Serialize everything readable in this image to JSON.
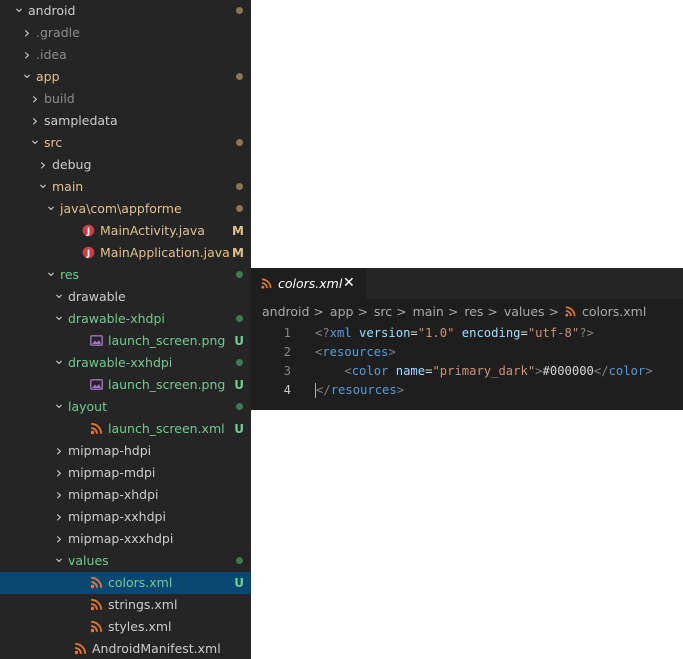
{
  "explorer": {
    "items": [
      {
        "label": "android",
        "depth": 0,
        "expanded": true,
        "status": "dot",
        "color": "#cccccc"
      },
      {
        "label": ".gradle",
        "depth": 1,
        "expanded": false,
        "status": "",
        "color": "#8b8b8b"
      },
      {
        "label": ".idea",
        "depth": 1,
        "expanded": false,
        "status": "",
        "color": "#8b8b8b"
      },
      {
        "label": "app",
        "depth": 1,
        "expanded": true,
        "status": "dot",
        "color": "#e2c08d"
      },
      {
        "label": "build",
        "depth": 2,
        "expanded": false,
        "status": "",
        "color": "#8b8b8b"
      },
      {
        "label": "sampledata",
        "depth": 2,
        "expanded": false,
        "status": "",
        "color": "#cccccc"
      },
      {
        "label": "src",
        "depth": 2,
        "expanded": true,
        "status": "dot",
        "color": "#e2c08d"
      },
      {
        "label": "debug",
        "depth": 3,
        "expanded": false,
        "status": "",
        "color": "#cccccc"
      },
      {
        "label": "main",
        "depth": 3,
        "expanded": true,
        "status": "dot",
        "color": "#e2c08d"
      },
      {
        "label": "java\\com\\appforme",
        "depth": 4,
        "expanded": true,
        "status": "dot",
        "color": "#e2c08d"
      },
      {
        "label": "MainActivity.java",
        "depth": 5,
        "file": "java",
        "status": "M",
        "color": "#e2c08d"
      },
      {
        "label": "MainApplication.java",
        "depth": 5,
        "file": "java",
        "status": "M",
        "color": "#e2c08d"
      },
      {
        "label": "res",
        "depth": 4,
        "expanded": true,
        "status": "dot",
        "color": "#73c991"
      },
      {
        "label": "drawable",
        "depth": 5,
        "expanded": true,
        "status": "",
        "color": "#cccccc"
      },
      {
        "label": "drawable-xhdpi",
        "depth": 5,
        "expanded": true,
        "status": "dot",
        "color": "#73c991"
      },
      {
        "label": "launch_screen.png",
        "depth": 6,
        "file": "image",
        "status": "U",
        "color": "#73c991"
      },
      {
        "label": "drawable-xxhdpi",
        "depth": 5,
        "expanded": true,
        "status": "dot",
        "color": "#73c991"
      },
      {
        "label": "launch_screen.png",
        "depth": 6,
        "file": "image",
        "status": "U",
        "color": "#73c991"
      },
      {
        "label": "layout",
        "depth": 5,
        "expanded": true,
        "status": "dot",
        "color": "#73c991"
      },
      {
        "label": "launch_screen.xml",
        "depth": 6,
        "file": "xml",
        "status": "U",
        "color": "#73c991"
      },
      {
        "label": "mipmap-hdpi",
        "depth": 5,
        "expanded": false,
        "status": "",
        "color": "#cccccc"
      },
      {
        "label": "mipmap-mdpi",
        "depth": 5,
        "expanded": false,
        "status": "",
        "color": "#cccccc"
      },
      {
        "label": "mipmap-xhdpi",
        "depth": 5,
        "expanded": false,
        "status": "",
        "color": "#cccccc"
      },
      {
        "label": "mipmap-xxhdpi",
        "depth": 5,
        "expanded": false,
        "status": "",
        "color": "#cccccc"
      },
      {
        "label": "mipmap-xxxhdpi",
        "depth": 5,
        "expanded": false,
        "status": "",
        "color": "#cccccc"
      },
      {
        "label": "values",
        "depth": 5,
        "expanded": true,
        "status": "dot",
        "color": "#73c991"
      },
      {
        "label": "colors.xml",
        "depth": 6,
        "file": "xml",
        "status": "U",
        "color": "#73c991",
        "selected": true
      },
      {
        "label": "strings.xml",
        "depth": 6,
        "file": "xml",
        "status": "",
        "color": "#cccccc"
      },
      {
        "label": "styles.xml",
        "depth": 6,
        "file": "xml",
        "status": "",
        "color": "#cccccc"
      },
      {
        "label": "AndroidManifest.xml",
        "depth": 4,
        "file": "xml",
        "status": "",
        "color": "#cccccc"
      }
    ]
  },
  "editor": {
    "tab": {
      "label": "colors.xml",
      "close": "✕"
    },
    "breadcrumb": [
      "android",
      "app",
      "src",
      "main",
      "res",
      "values",
      "colors.xml"
    ],
    "separator": ">",
    "lines": [
      {
        "n": "1",
        "tokens": [
          [
            "punc",
            "<?"
          ],
          [
            "tag",
            "xml"
          ],
          [
            "txt",
            " "
          ],
          [
            "attr",
            "version"
          ],
          [
            "txt",
            "="
          ],
          [
            "str",
            "\"1.0\""
          ],
          [
            "txt",
            " "
          ],
          [
            "attr",
            "encoding"
          ],
          [
            "txt",
            "="
          ],
          [
            "str",
            "\"utf-8\""
          ],
          [
            "punc",
            "?>"
          ]
        ]
      },
      {
        "n": "2",
        "tokens": [
          [
            "punc",
            "<"
          ],
          [
            "tag",
            "resources"
          ],
          [
            "punc",
            ">"
          ]
        ]
      },
      {
        "n": "3",
        "tokens": [
          [
            "txt",
            "    "
          ],
          [
            "punc",
            "<"
          ],
          [
            "tag",
            "color"
          ],
          [
            "txt",
            " "
          ],
          [
            "attr",
            "name"
          ],
          [
            "txt",
            "="
          ],
          [
            "str",
            "\"primary_dark\""
          ],
          [
            "punc",
            ">"
          ],
          [
            "txt",
            "#000000"
          ],
          [
            "punc",
            "</"
          ],
          [
            "tag",
            "color"
          ],
          [
            "punc",
            ">"
          ]
        ]
      },
      {
        "n": "4",
        "tokens": [
          [
            "cursor",
            ""
          ],
          [
            "punc",
            "</"
          ],
          [
            "tag",
            "resources"
          ],
          [
            "punc",
            ">"
          ]
        ],
        "active": true
      }
    ]
  },
  "colors": {
    "modified": "#e2c08d",
    "untracked": "#73c991",
    "selection": "#094771",
    "java_icon": "#cc3e44",
    "xml_icon": "#e37933",
    "image_icon": "#a074c4"
  },
  "icons": {
    "chevron_expanded": "chevron-down-icon",
    "chevron_collapsed": "chevron-right-icon",
    "java": "java-file-icon",
    "xml": "rss-xml-file-icon",
    "image": "image-file-icon"
  }
}
